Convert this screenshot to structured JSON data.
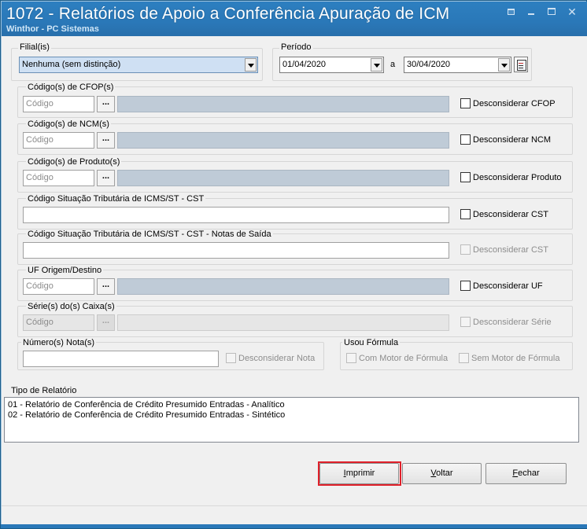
{
  "window": {
    "title": "1072 - Relatórios de Apoio a Conferência Apuração de ICM",
    "subtitle": "Winthor - PC Sistemas"
  },
  "filial": {
    "label": "Filial(is)",
    "value": "Nenhuma (sem distinção)"
  },
  "periodo": {
    "label": "Período",
    "start": "01/04/2020",
    "separator": "a",
    "end": "30/04/2020"
  },
  "cfop": {
    "label": "Código(s) de CFOP(s)",
    "placeholder": "Código",
    "dots": "...",
    "checkbox": "Desconsiderar CFOP"
  },
  "ncm": {
    "label": "Código(s) de NCM(s)",
    "placeholder": "Código",
    "dots": "...",
    "checkbox": "Desconsiderar NCM"
  },
  "produto": {
    "label": "Código(s) de Produto(s)",
    "placeholder": "Código",
    "dots": "...",
    "checkbox": "Desconsiderar Produto"
  },
  "cst": {
    "label": "Código Situação Tributária de ICMS/ST - CST",
    "checkbox": "Desconsiderar CST"
  },
  "cst_saida": {
    "label": "Código Situação Tributária de ICMS/ST - CST -  Notas de Saída",
    "checkbox": "Desconsiderar CST"
  },
  "uf": {
    "label": "UF Origem/Destino",
    "placeholder": "Código",
    "dots": "...",
    "checkbox": "Desconsiderar UF"
  },
  "serie": {
    "label": "Série(s) do(s) Caixa(s)",
    "placeholder": "Código",
    "dots": "...",
    "checkbox": "Desconsiderar Série"
  },
  "nota": {
    "label": "Número(s) Nota(s)",
    "checkbox": "Desconsiderar Nota"
  },
  "formula": {
    "label": "Usou Fórmula",
    "opt1": "Com Motor de Fórmula",
    "opt2": "Sem Motor de Fórmula"
  },
  "relatorio": {
    "label": "Tipo de Relatório",
    "items": [
      "01 - Relatório de Conferência de Crédito Presumido Entradas - Analítico",
      "02 - Relatório de Conferência de Crédito Presumido Entradas - Sintético"
    ]
  },
  "buttons": {
    "imprimir_ul": "I",
    "imprimir_rest": "mprimir",
    "voltar_ul": "V",
    "voltar_rest": "oltar",
    "fechar_ul": "F",
    "fechar_rest": "echar"
  },
  "colors": {
    "title_bar": "#2a78b8",
    "highlight": "#e0202a"
  }
}
